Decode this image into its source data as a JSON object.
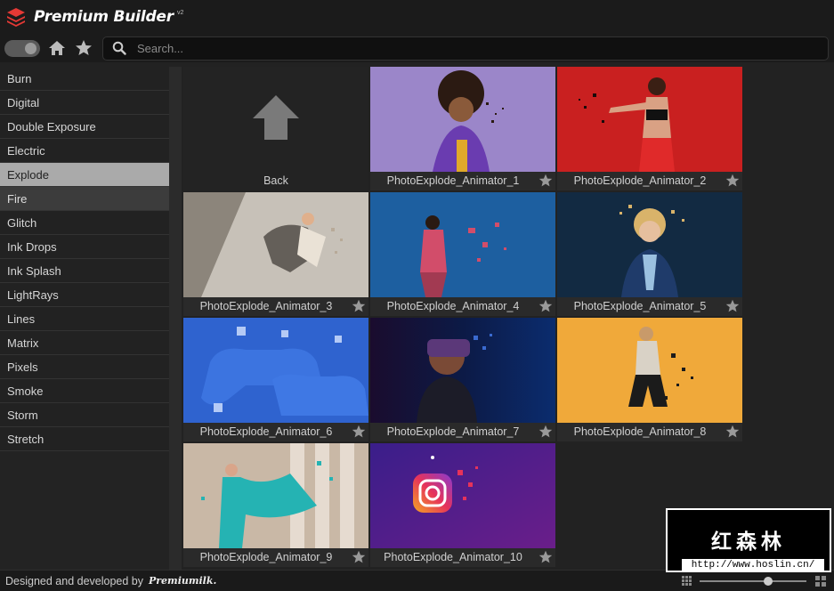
{
  "header": {
    "title": "Premium Builder",
    "version": "v2",
    "logo_icon": "layers-icon"
  },
  "toolbar": {
    "toggle_state": "on",
    "home_icon": "home-icon",
    "favorites_icon": "star-icon",
    "search_icon": "search-icon",
    "search_placeholder": "Search...",
    "search_value": ""
  },
  "sidebar": {
    "categories": [
      {
        "label": "Burn"
      },
      {
        "label": "Digital"
      },
      {
        "label": "Double Exposure"
      },
      {
        "label": "Electric"
      },
      {
        "label": "Explode"
      },
      {
        "label": "Fire"
      },
      {
        "label": "Glitch"
      },
      {
        "label": "Ink Drops"
      },
      {
        "label": "Ink Splash"
      },
      {
        "label": "LightRays"
      },
      {
        "label": "Lines"
      },
      {
        "label": "Matrix"
      },
      {
        "label": "Pixels"
      },
      {
        "label": "Smoke"
      },
      {
        "label": "Storm"
      },
      {
        "label": "Stretch"
      }
    ],
    "selected": "Explode"
  },
  "grid": {
    "back_label": "Back",
    "items": [
      {
        "label": "PhotoExplode_Animator_1"
      },
      {
        "label": "PhotoExplode_Animator_2"
      },
      {
        "label": "PhotoExplode_Animator_3"
      },
      {
        "label": "PhotoExplode_Animator_4"
      },
      {
        "label": "PhotoExplode_Animator_5"
      },
      {
        "label": "PhotoExplode_Animator_6"
      },
      {
        "label": "PhotoExplode_Animator_7"
      },
      {
        "label": "PhotoExplode_Animator_8"
      },
      {
        "label": "PhotoExplode_Animator_9"
      },
      {
        "label": "PhotoExplode_Animator_10"
      }
    ]
  },
  "footer": {
    "text": "Designed and developed by",
    "brand": "Premiumilk."
  },
  "watermark": {
    "title": "红森林",
    "url": "http://www.hoslin.cn/"
  },
  "colors": {
    "selected_category": "#aaaaaa",
    "background": "#222222"
  }
}
